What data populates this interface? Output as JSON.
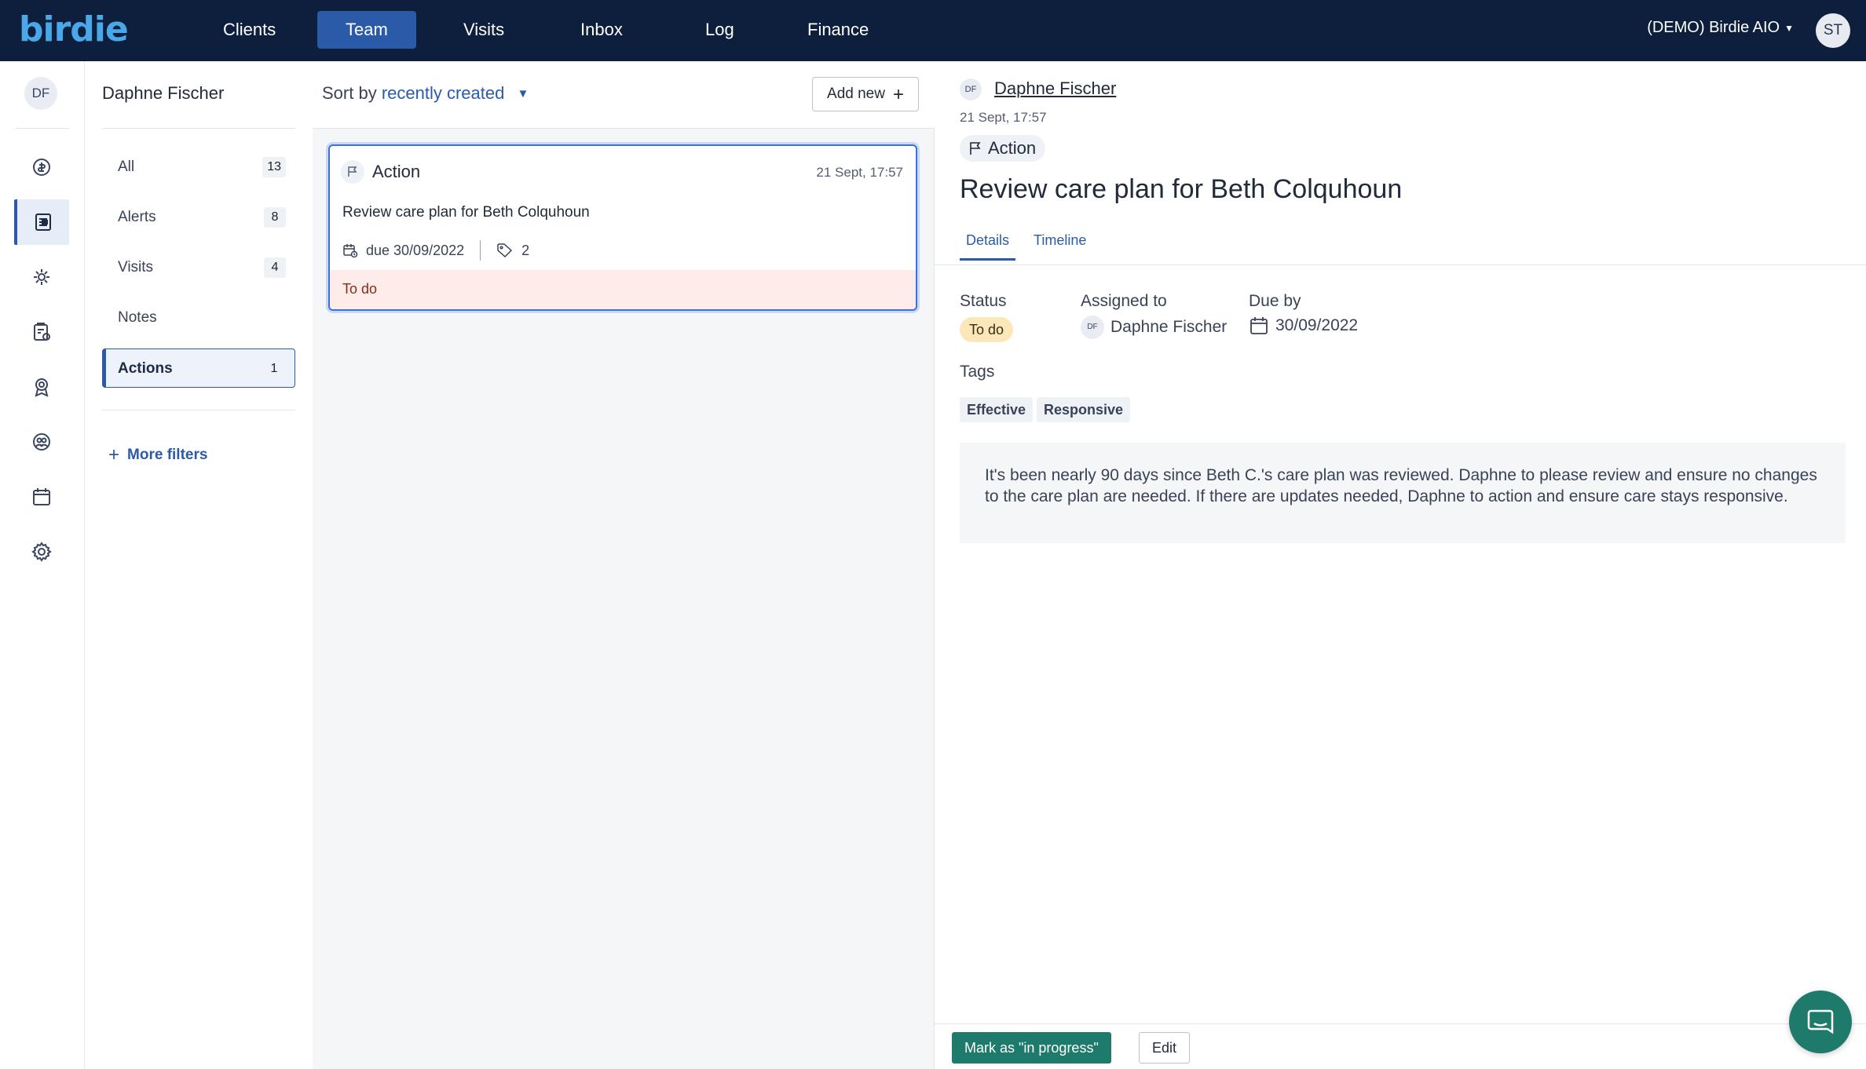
{
  "brand": {
    "logo": "birdie"
  },
  "nav": {
    "items": [
      {
        "label": "Clients"
      },
      {
        "label": "Team"
      },
      {
        "label": "Visits"
      },
      {
        "label": "Inbox"
      },
      {
        "label": "Log"
      },
      {
        "label": "Finance"
      }
    ],
    "active": "Team",
    "org": "(DEMO) Birdie AIO",
    "user_initials": "ST"
  },
  "rail": {
    "avatar_initials": "DF",
    "icons": [
      "finance-icon",
      "notes-icon",
      "settings-cog-icon",
      "checklist-icon",
      "award-icon",
      "people-icon",
      "calendar-icon",
      "gear-icon"
    ],
    "active_icon": "notes-icon"
  },
  "filters": {
    "title": "Daphne Fischer",
    "items": [
      {
        "label": "All",
        "count": "13"
      },
      {
        "label": "Alerts",
        "count": "8"
      },
      {
        "label": "Visits",
        "count": "4"
      },
      {
        "label": "Notes",
        "count": ""
      },
      {
        "label": "Actions",
        "count": "1"
      }
    ],
    "active": "Actions",
    "more_filters": "More filters"
  },
  "list": {
    "sort_label": "Sort by",
    "sort_value": "recently created",
    "add_new": "Add new",
    "card": {
      "type": "Action",
      "time": "21 Sept, 17:57",
      "title": "Review care plan for Beth Colquhoun",
      "due": "due 30/09/2022",
      "tag_count": "2",
      "status": "To do"
    }
  },
  "detail": {
    "avatar_initials": "DF",
    "author": "Daphne Fischer",
    "time": "21 Sept, 17:57",
    "type": "Action",
    "title": "Review care plan for Beth Colquhoun",
    "tabs": [
      {
        "label": "Details"
      },
      {
        "label": "Timeline"
      }
    ],
    "active_tab": "Details",
    "status_label": "Status",
    "status_value": "To do",
    "assigned_label": "Assigned to",
    "assigned_initials": "DF",
    "assigned_value": "Daphne Fischer",
    "due_label": "Due by",
    "due_value": "30/09/2022",
    "tags_label": "Tags",
    "tags": [
      "Effective",
      "Responsive"
    ],
    "description": "It's been nearly 90 days since Beth C.'s care plan was reviewed. Daphne to please review and ensure no changes to the care plan are needed. If there are updates needed, Daphne to action and ensure care stays responsive.",
    "primary_action": "Mark as \"in progress\"",
    "edit_action": "Edit"
  },
  "colors": {
    "topbar": "#0d1f3c",
    "accent": "#2a5aa8",
    "primary_button": "#1e7a6a",
    "status_todo_bg": "#fdecea",
    "status_pill_bg": "#fbe7b9"
  }
}
